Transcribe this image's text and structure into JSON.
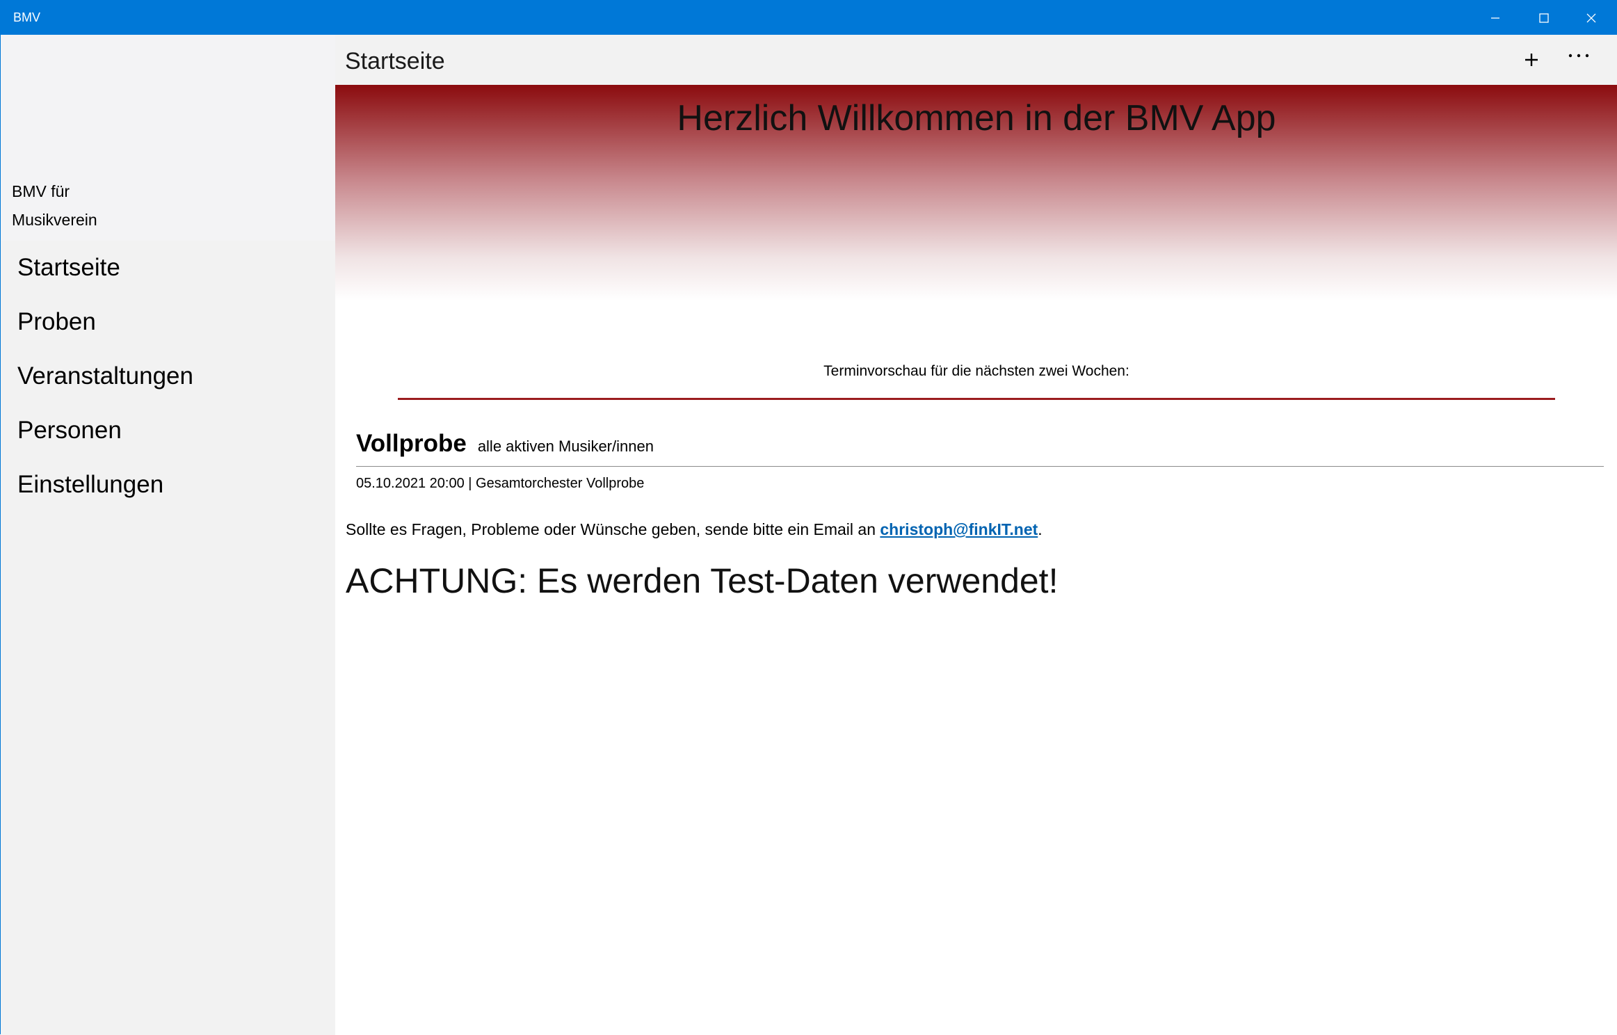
{
  "window": {
    "title": "BMV"
  },
  "sidebar": {
    "brand_line1": "BMV für",
    "brand_line2": "Musikverein",
    "items": [
      {
        "label": "Startseite"
      },
      {
        "label": "Proben"
      },
      {
        "label": "Veranstaltungen"
      },
      {
        "label": "Personen"
      },
      {
        "label": "Einstellungen"
      }
    ]
  },
  "header": {
    "title": "Startseite",
    "add_icon": "plus-icon",
    "more_icon": "ellipsis-icon"
  },
  "main": {
    "welcome": "Herzlich Willkommen in der BMV App",
    "preview_caption": "Terminvorschau für die nächsten zwei Wochen:",
    "event": {
      "title": "Vollprobe",
      "group": "alle aktiven Musiker/innen",
      "detail": "05.10.2021 20:00 | Gesamtorchester Vollprobe"
    },
    "contact_text": "Sollte es Fragen, Probleme oder Wünsche geben, sende bitte ein Email an",
    "contact_email": "christoph@finkIT.net",
    "contact_suffix": ".",
    "warning": "ACHTUNG: Es werden Test-Daten verwendet!"
  },
  "colors": {
    "titlebar": "#0078d7",
    "banner_top": "#8b0b0e",
    "accent_line": "#9b1c1f",
    "link": "#0063b1"
  }
}
